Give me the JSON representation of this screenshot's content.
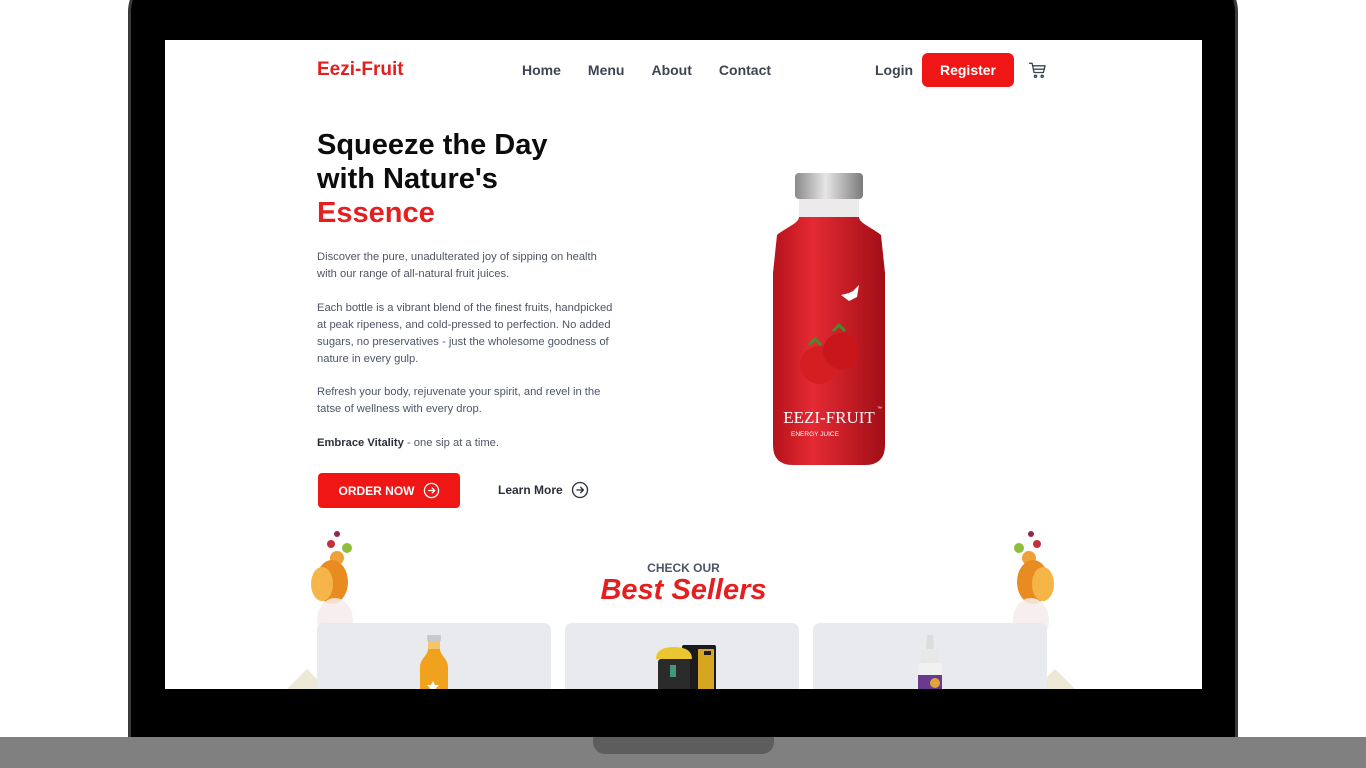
{
  "brand": {
    "name": "Eezi-Fruit"
  },
  "nav": {
    "links": [
      "Home",
      "Menu",
      "About",
      "Contact"
    ],
    "login": "Login",
    "register": "Register"
  },
  "hero": {
    "title_line1": "Squeeze the Day",
    "title_line2": "with Nature's",
    "title_accent": "Essence",
    "paragraph1": "Discover the pure, unadulterated joy of sipping on health with our range of all-natural fruit juices.",
    "paragraph2": "Each bottle is a vibrant blend of the finest fruits, handpicked at peak ripeness, and cold-pressed to perfection. No added sugars, no preservatives - just the wholesome goodness of nature in every gulp.",
    "paragraph3": "Refresh your body, rejuvenate your spirit, and revel in the tatse of wellness with every drop.",
    "tagline_bold": "Embrace Vitality",
    "tagline_rest": " - one sip at a time.",
    "order_button": "ORDER NOW",
    "learn_more": "Learn More"
  },
  "product_label": {
    "brand": "EEZI-FRUIT",
    "tm": "™",
    "sub": "ENERGY JUICE"
  },
  "best_sellers": {
    "kicker": "CHECK OUR",
    "title": "Best Sellers"
  },
  "icons": {
    "cart": "cart-icon",
    "arrow": "arrow-circle-right-icon"
  },
  "colors": {
    "accent": "#f01616",
    "brand_text": "#e41f1f",
    "card_bg": "#e9eaed"
  }
}
